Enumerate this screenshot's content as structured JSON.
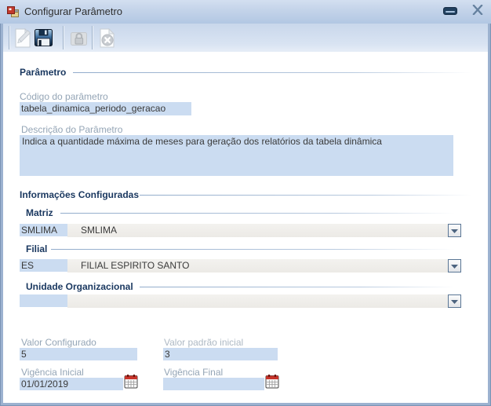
{
  "window": {
    "title": "Configurar Parâmetro",
    "icons": {
      "app": "winforms-form-icon",
      "minimize": "minimize-icon",
      "close": "close-icon"
    }
  },
  "toolbar": {
    "buttons": [
      {
        "name": "edit",
        "icon": "pencil-document-icon",
        "enabled": false
      },
      {
        "name": "save",
        "icon": "save-floppy-icon",
        "enabled": true
      },
      {
        "name": "lock",
        "icon": "lock-icon",
        "enabled": false
      },
      {
        "name": "cancel",
        "icon": "cancel-icon",
        "enabled": false
      }
    ]
  },
  "parametro": {
    "header": "Parâmetro",
    "codigo": {
      "label": "Código do parâmetro",
      "value": "tabela_dinamica_periodo_geracao"
    },
    "descricao": {
      "label": "Descrição do Parâmetro",
      "value": "Indica a quantidade máxima de meses para geração dos relatórios da tabela dinâmica"
    }
  },
  "informacoes": {
    "header": "Informações Configuradas",
    "matriz": {
      "header": "Matriz",
      "code": "SMLIMA",
      "name": "SMLIMA"
    },
    "filial": {
      "header": "Filial",
      "code": "ES",
      "name": "FILIAL ESPIRITO SANTO"
    },
    "unidade": {
      "header": "Unidade Organizacional",
      "code": "",
      "name": ""
    }
  },
  "valores": {
    "valor_configurado": {
      "label": "Valor Configurado",
      "value": "5"
    },
    "valor_padrao_inicial": {
      "label": "Valor padrão inicial",
      "value": "3"
    },
    "vigencia_inicial": {
      "label": "Vigência Inicial",
      "value": "01/01/2019"
    },
    "vigencia_final": {
      "label": "Vigência Final",
      "value": ""
    }
  },
  "colors": {
    "titlebar": "#c3d3e9",
    "frame": "#9cb2d0",
    "textbox_fill": "#cbdcf1",
    "section_header": "#19375f",
    "label": "#94a5b6",
    "calendar_red": "#c8342b"
  }
}
